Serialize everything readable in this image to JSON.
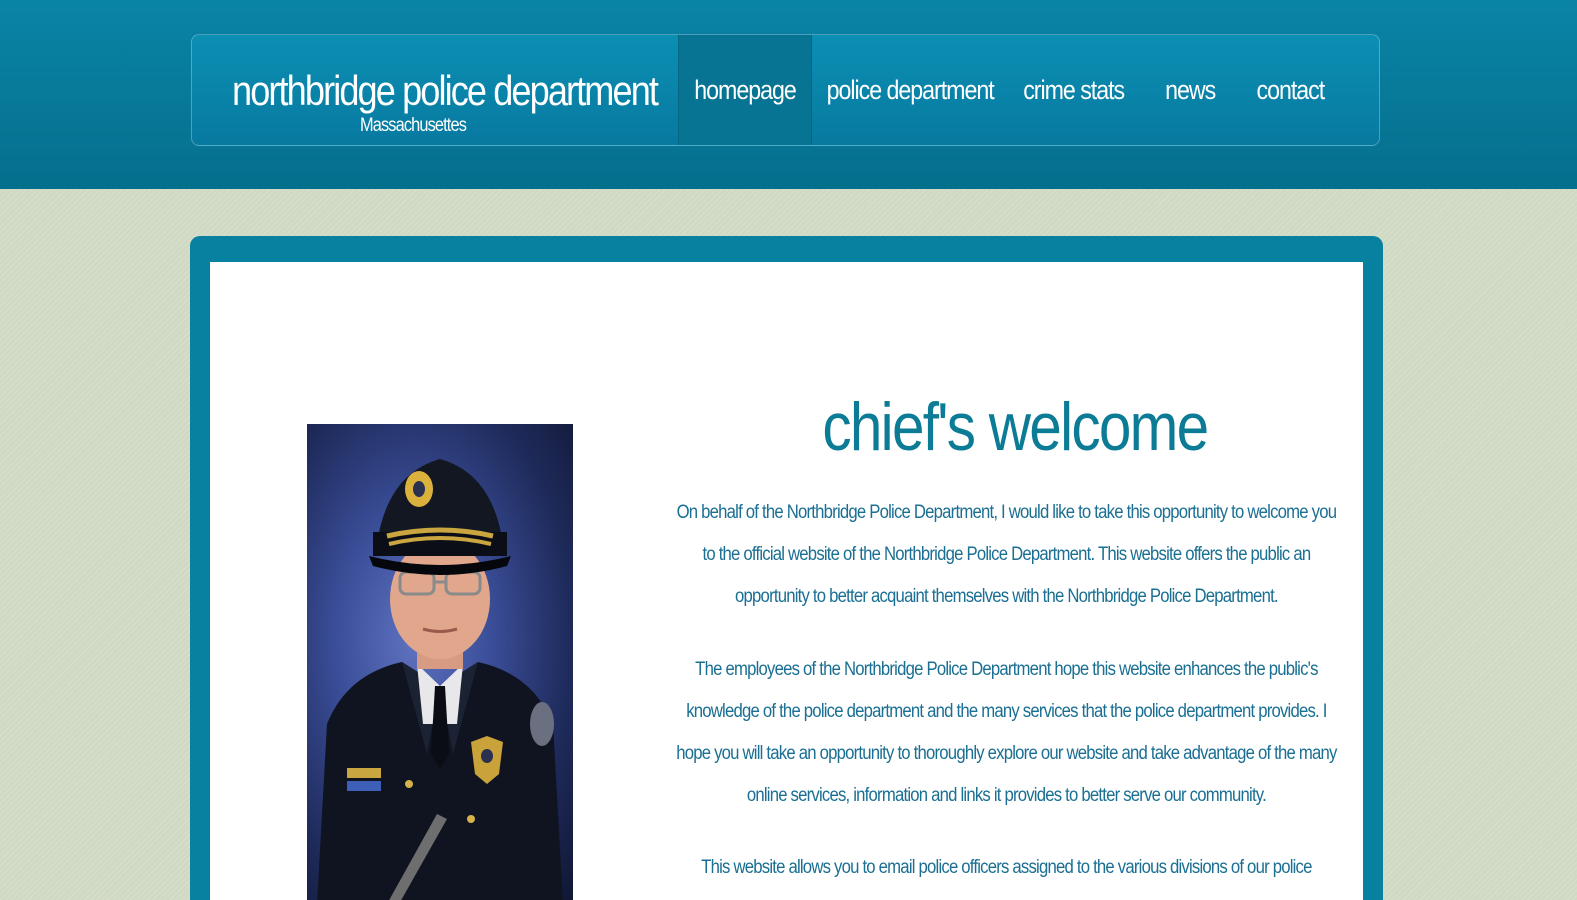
{
  "header": {
    "title": "northbridge police department",
    "subtitle": "Massachusettes"
  },
  "nav": {
    "items": [
      {
        "label": "homepage",
        "active": true
      },
      {
        "label": "police department",
        "active": false
      },
      {
        "label": "crime stats",
        "active": false
      },
      {
        "label": "news",
        "active": false
      },
      {
        "label": "contact",
        "active": false
      }
    ]
  },
  "main": {
    "heading": "chief's welcome",
    "paragraphs": [
      "On behalf of the Northbridge Police Department, I would like to take this opportunity to welcome you to the official website of the Northbridge Police Department. This website offers the public an opportunity to better acquaint themselves with the Northbridge Police Department.",
      "The employees of the Northbridge Police Department hope this website enhances the public's knowledge of the police department and the many services that the police department provides. I hope you will take an opportunity to thoroughly explore our website and take advantage of the many online services, information and links it provides to better serve our community.",
      "This website allows you to email police officers assigned to the various divisions of our police department, please feel"
    ]
  },
  "colors": {
    "header_blue": "#0a84a6",
    "heading_teal": "#0b7b96",
    "body_text": "#1a6f93",
    "background": "#cfd9c3"
  }
}
